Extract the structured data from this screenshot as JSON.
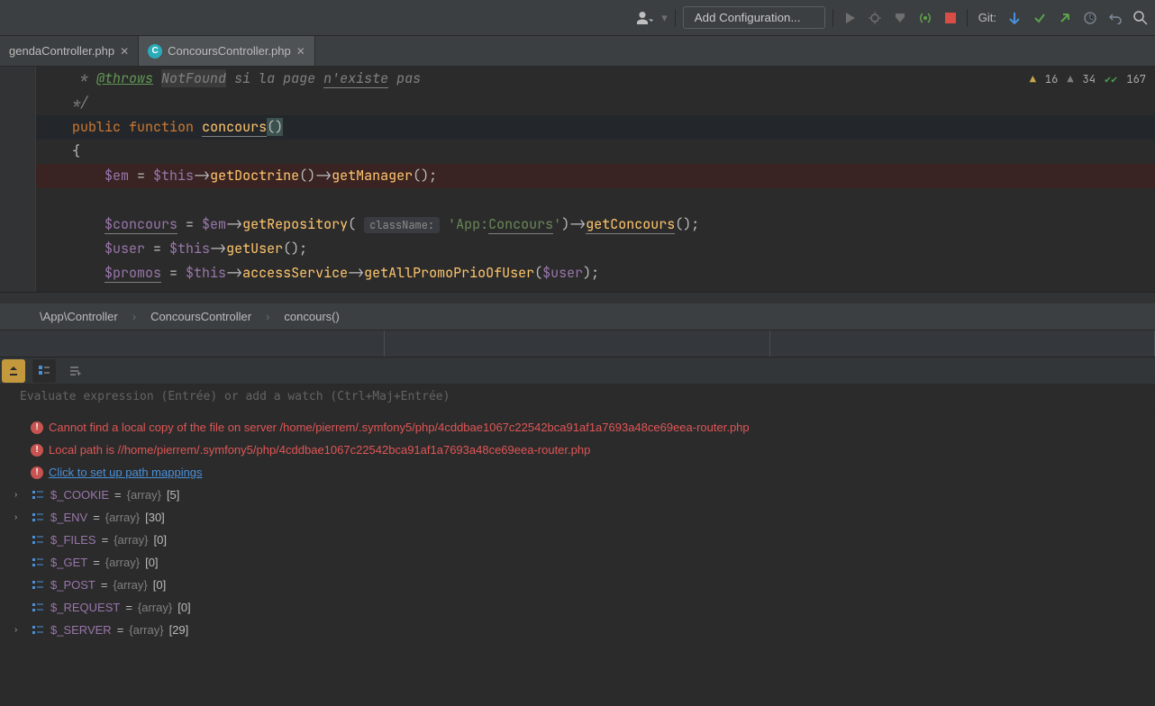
{
  "toolbar": {
    "config_label": "Add Configuration...",
    "git_label": "Git:"
  },
  "tabs": [
    {
      "name": "gendaController.php",
      "active": false
    },
    {
      "name": "ConcoursController.php",
      "active": true
    }
  ],
  "inspections": {
    "errors": "16",
    "warnings": "34",
    "passed": "167"
  },
  "code": {
    "comment_tag": "@throws",
    "comment_cls": "NotFound",
    "comment_rest": " si la page ",
    "comment_nexiste": "n'existe",
    "comment_pas": " pas",
    "comment_close": "*/",
    "public": "public",
    "function": "function",
    "concours": "concours",
    "parens": "()",
    "brace_open": "{",
    "em_var": "$em",
    "this_var": "$this",
    "arrow": "->",
    "getDoctrine": "getDoctrine",
    "getManager": "getManager",
    "semicolon": ";",
    "concours_var": "$concours",
    "eq": " = ",
    "getRepository": "getRepository",
    "open_paren": "(",
    "close_paren": ")",
    "hint_classname": "className:",
    "repo_str1": "'App:",
    "repo_cls": "Concours",
    "repo_str2": "'",
    "getConcours": "getConcours",
    "user_var": "$user",
    "getUser": "getUser",
    "promos_var": "$promos",
    "accessService": "accessService",
    "getAllPromoPrioOfUser": "getAllPromoPrioOfUser"
  },
  "breadcrumbs": [
    "\\App\\Controller",
    "ConcoursController",
    "concours()"
  ],
  "debug": {
    "eval_placeholder": "Evaluate expression (Entrée) or add a watch (Ctrl+Maj+Entrée)"
  },
  "messages": {
    "err1": "Cannot find a local copy of the file on server /home/pierrem/.symfony5/php/4cddbae1067c22542bca91af1a7693a48ce69eea-router.php",
    "err2": "Local path is //home/pierrem/.symfony5/php/4cddbae1067c22542bca91af1a7693a48ce69eea-router.php",
    "link": "Click to set up path mappings"
  },
  "variables": [
    {
      "name": "$_COOKIE",
      "type": "{array}",
      "count": "[5]",
      "expandable": true
    },
    {
      "name": "$_ENV",
      "type": "{array}",
      "count": "[30]",
      "expandable": true
    },
    {
      "name": "$_FILES",
      "type": "{array}",
      "count": "[0]",
      "expandable": false
    },
    {
      "name": "$_GET",
      "type": "{array}",
      "count": "[0]",
      "expandable": false
    },
    {
      "name": "$_POST",
      "type": "{array}",
      "count": "[0]",
      "expandable": false
    },
    {
      "name": "$_REQUEST",
      "type": "{array}",
      "count": "[0]",
      "expandable": false
    },
    {
      "name": "$_SERVER",
      "type": "{array}",
      "count": "[29]",
      "expandable": true
    }
  ]
}
